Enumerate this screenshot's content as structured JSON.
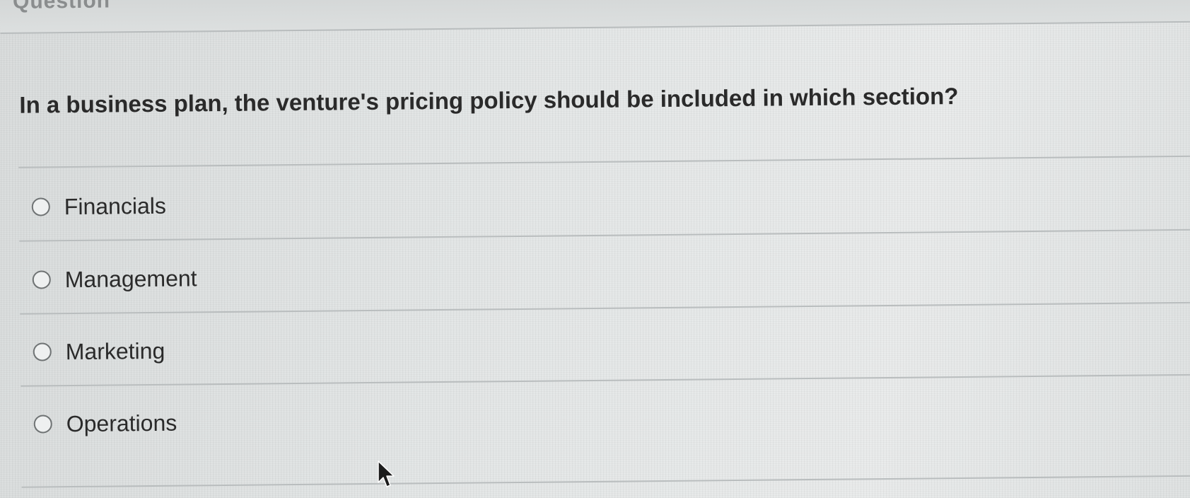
{
  "header": {
    "title": "Question"
  },
  "question": {
    "text": "In a business plan, the venture's pricing policy should be included in which section?"
  },
  "options": [
    {
      "label": "Financials",
      "selected": false
    },
    {
      "label": "Management",
      "selected": false
    },
    {
      "label": "Marketing",
      "selected": false
    },
    {
      "label": "Operations",
      "selected": false
    }
  ],
  "icons": {
    "radio": "radio-unselected-icon",
    "pointer": "mouse-cursor-icon"
  }
}
